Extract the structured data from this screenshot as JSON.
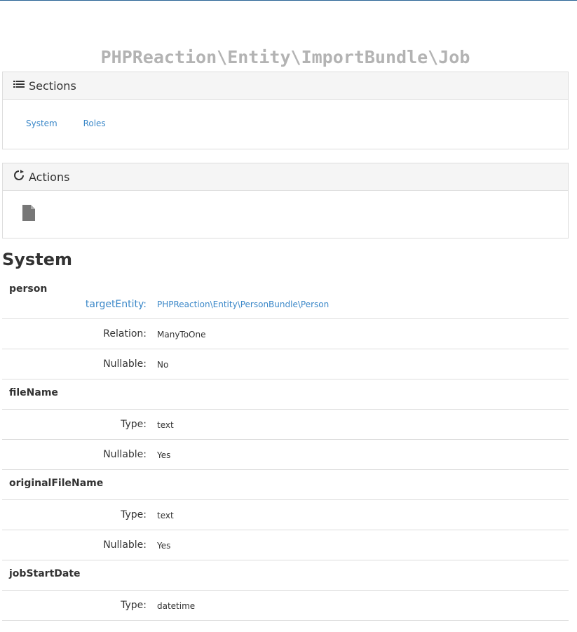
{
  "page": {
    "title": "PHPReaction\\Entity\\ImportBundle\\Job"
  },
  "sections_panel": {
    "title": "Sections",
    "links": [
      "System",
      "Roles"
    ]
  },
  "actions_panel": {
    "title": "Actions"
  },
  "system": {
    "heading": "System",
    "fields": [
      {
        "name": "person",
        "props": [
          {
            "label": "targetEntity:",
            "value": "PHPReaction\\Entity\\PersonBundle\\Person"
          },
          {
            "label": "Relation:",
            "value": "ManyToOne"
          },
          {
            "label": "Nullable:",
            "value": "No"
          }
        ]
      },
      {
        "name": "fileName",
        "props": [
          {
            "label": "Type:",
            "value": "text"
          },
          {
            "label": "Nullable:",
            "value": "Yes"
          }
        ]
      },
      {
        "name": "originalFileName",
        "props": [
          {
            "label": "Type:",
            "value": "text"
          },
          {
            "label": "Nullable:",
            "value": "Yes"
          }
        ]
      },
      {
        "name": "jobStartDate",
        "props": [
          {
            "label": "Type:",
            "value": "datetime"
          }
        ]
      }
    ]
  },
  "colors": {
    "link": "#3a87c8",
    "title": "#b3b3b3"
  }
}
